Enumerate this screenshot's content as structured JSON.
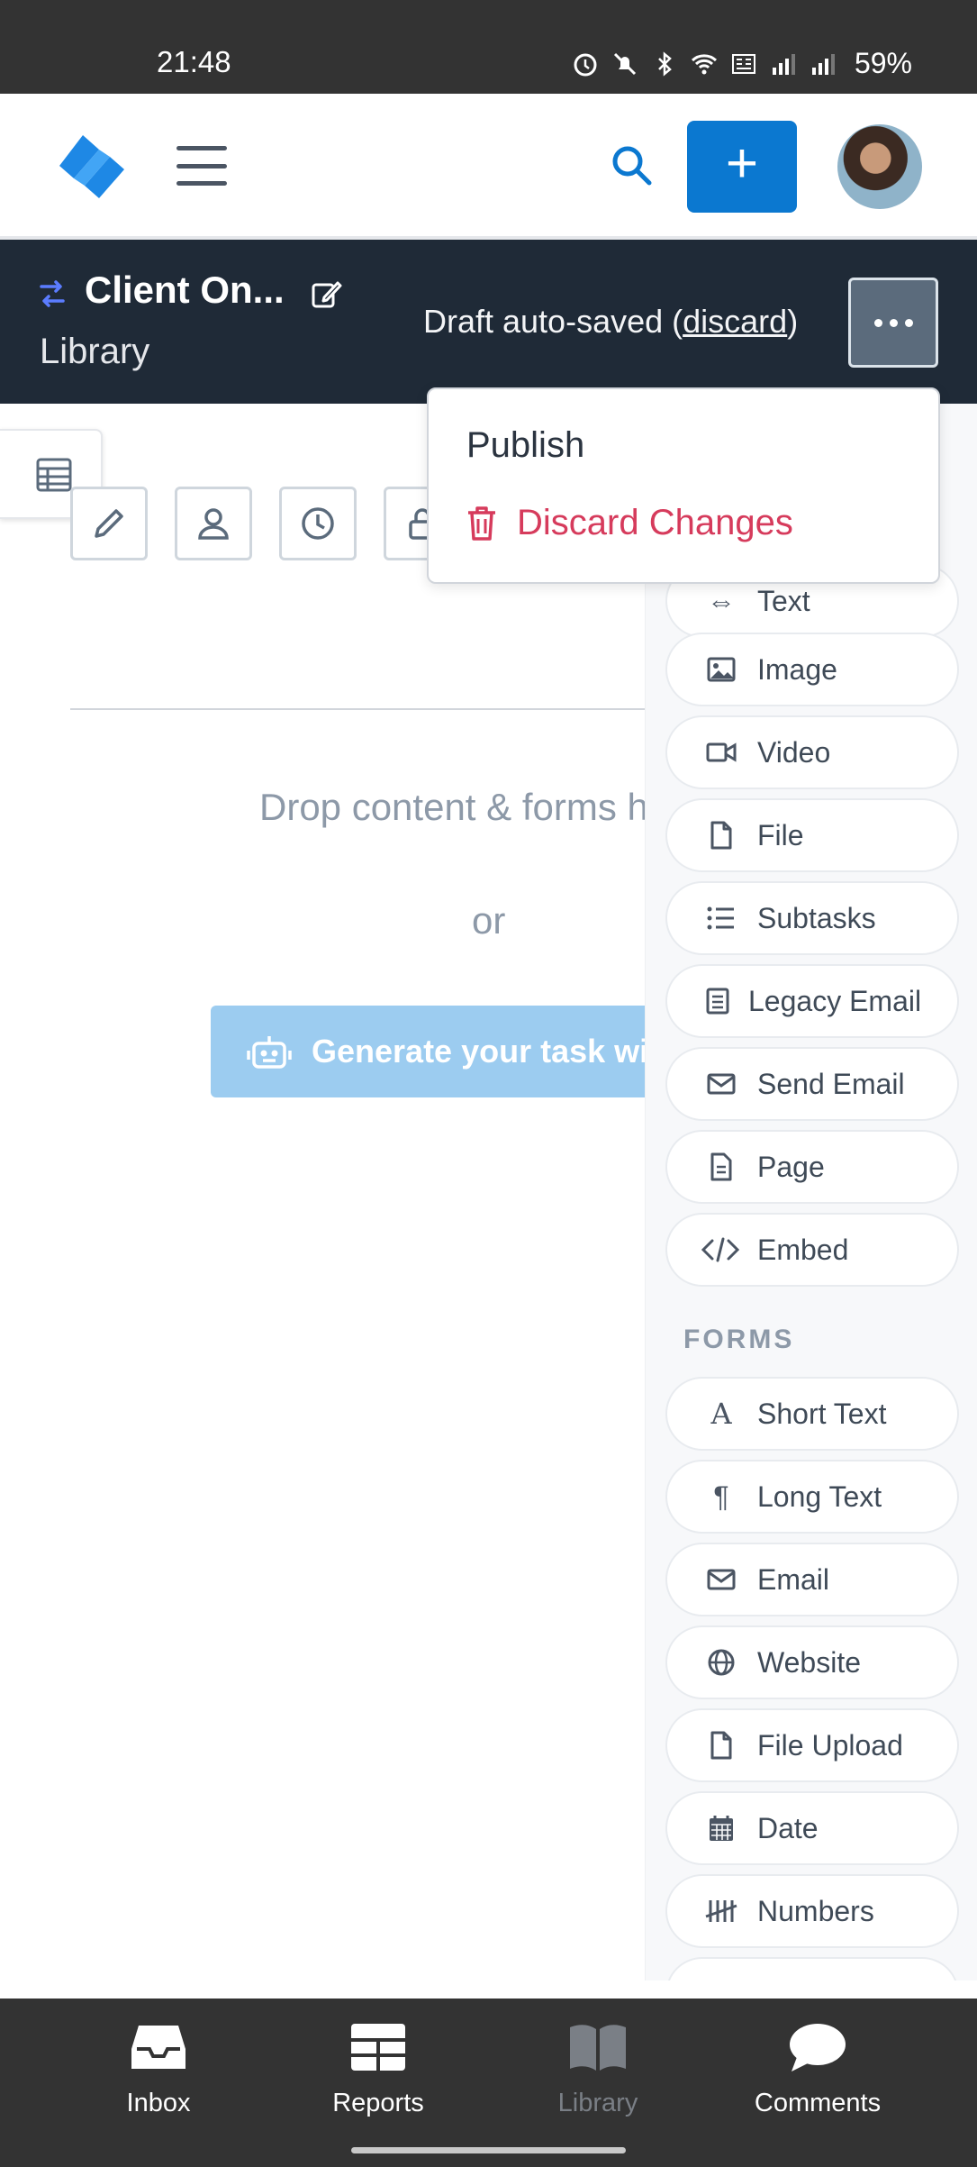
{
  "status_bar": {
    "time": "21:48",
    "battery": "59%"
  },
  "header": {
    "add_label": "+"
  },
  "title_bar": {
    "title": "Client On...",
    "subtitle": "Library",
    "draft_prefix": "Draft auto-saved (",
    "discard_link": "discard",
    "draft_suffix": ")"
  },
  "dropdown": {
    "publish": "Publish",
    "discard_changes": "Discard Changes"
  },
  "canvas": {
    "drop_text": "Drop content & forms here",
    "or_text": "or",
    "generate_button": "Generate your task with AI"
  },
  "content_items": [
    {
      "label": "Text",
      "icon": "text-icon"
    },
    {
      "label": "Image",
      "icon": "image-icon"
    },
    {
      "label": "Video",
      "icon": "video-icon"
    },
    {
      "label": "File",
      "icon": "file-icon"
    },
    {
      "label": "Subtasks",
      "icon": "list-icon"
    },
    {
      "label": "Legacy Email",
      "icon": "legacy-email-icon"
    },
    {
      "label": "Send Email",
      "icon": "envelope-icon"
    },
    {
      "label": "Page",
      "icon": "page-icon"
    },
    {
      "label": "Embed",
      "icon": "code-icon"
    }
  ],
  "forms_heading": "FORMS",
  "form_items": [
    {
      "label": "Short Text",
      "icon": "letter-a-icon"
    },
    {
      "label": "Long Text",
      "icon": "pilcrow-icon"
    },
    {
      "label": "Email",
      "icon": "envelope-icon"
    },
    {
      "label": "Website",
      "icon": "globe-icon"
    },
    {
      "label": "File Upload",
      "icon": "file-icon"
    },
    {
      "label": "Date",
      "icon": "calendar-icon"
    },
    {
      "label": "Numbers",
      "icon": "tally-icon"
    }
  ],
  "bottom_nav": [
    {
      "label": "Inbox",
      "icon": "inbox-icon"
    },
    {
      "label": "Reports",
      "icon": "reports-icon"
    },
    {
      "label": "Library",
      "icon": "book-icon"
    },
    {
      "label": "Comments",
      "icon": "comment-icon"
    }
  ],
  "colors": {
    "primary": "#0b78d0",
    "title_bar": "#1f2a37",
    "danger": "#d63b5c",
    "muted_text": "#8d99a8",
    "generate_button": "#9cccf0"
  }
}
